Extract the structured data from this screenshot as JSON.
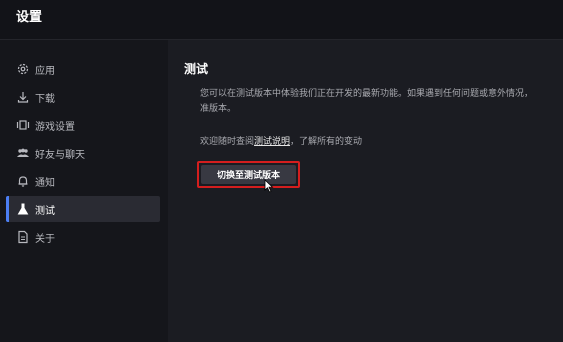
{
  "window": {
    "title": "设置"
  },
  "sidebar": {
    "items": [
      {
        "label": "应用",
        "icon": "gear-icon",
        "active": false
      },
      {
        "label": "下载",
        "icon": "download-icon",
        "active": false
      },
      {
        "label": "游戏设置",
        "icon": "game-settings-icon",
        "active": false
      },
      {
        "label": "好友与聊天",
        "icon": "friends-icon",
        "active": false
      },
      {
        "label": "通知",
        "icon": "bell-icon",
        "active": false
      },
      {
        "label": "测试",
        "icon": "flask-icon",
        "active": true
      },
      {
        "label": "关于",
        "icon": "document-icon",
        "active": false
      }
    ]
  },
  "main": {
    "title": "测试",
    "description_line1": "您可以在测试版本中体验我们正在开发的最新功能。如果遇到任何问题或意外情况，",
    "description_line2": "准版本。",
    "note_prefix": "欢迎随时查阅",
    "note_link": "测试说明",
    "note_suffix": "，了解所有的变动",
    "switch_button_label": "切换至测试版本"
  },
  "colors": {
    "accent": "#4c7ff5",
    "highlight": "#d41e1e",
    "background": "#16171c"
  }
}
